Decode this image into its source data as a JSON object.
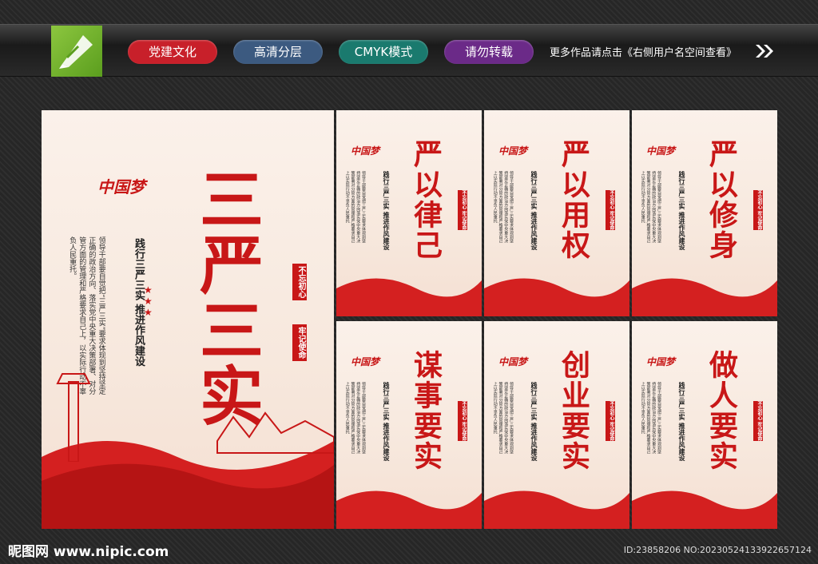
{
  "header": {
    "tags": [
      {
        "label": "党建文化",
        "color": "#c8202a"
      },
      {
        "label": "高清分层",
        "color": "#3c5a80"
      },
      {
        "label": "CMYK模式",
        "color": "#1a7a6e"
      },
      {
        "label": "请勿转载",
        "color": "#6b2a88"
      }
    ],
    "note": "更多作品请点击《右侧用户名空间查看》",
    "arrow_icon": "double-chevron-right-icon",
    "logo_icon": "pen-logo-icon"
  },
  "main_poster": {
    "title": "三严三实",
    "logo_text": "中国梦",
    "subtitle": "践行三严三实 推进作风建设",
    "body": "领导干部要自觉把“三严三实”要求体现到坚持坚定正确的政治方向、落实党中央重大决策部署、对分管方面的管理和严格要求自己上，以实际行动不辜负人民重托。",
    "seal": [
      "不忘初心",
      "牢记使命"
    ]
  },
  "small_posters": [
    {
      "title": "严以律己"
    },
    {
      "title": "严以用权"
    },
    {
      "title": "严以修身"
    },
    {
      "title": "谋事要实"
    },
    {
      "title": "创业要实"
    },
    {
      "title": "做人要实"
    }
  ],
  "small_common": {
    "logo_text": "中国梦",
    "subtitle": "践行三严三实 推进作风建设",
    "body": "领导干部要自觉把三严三实要求体现到坚持坚定正确的政治方向落实党中央重大决策部署对分管方面的管理和严格要求自己上以实际行动不辜负人民重托",
    "seal": "不忘初心 牢记使命"
  },
  "footer": {
    "site": "昵图网 www.nipic.com",
    "id": "ID:23858206 NO:20230524133922657124"
  },
  "colors": {
    "accent": "#c81717",
    "background": "#2b2b2b"
  }
}
